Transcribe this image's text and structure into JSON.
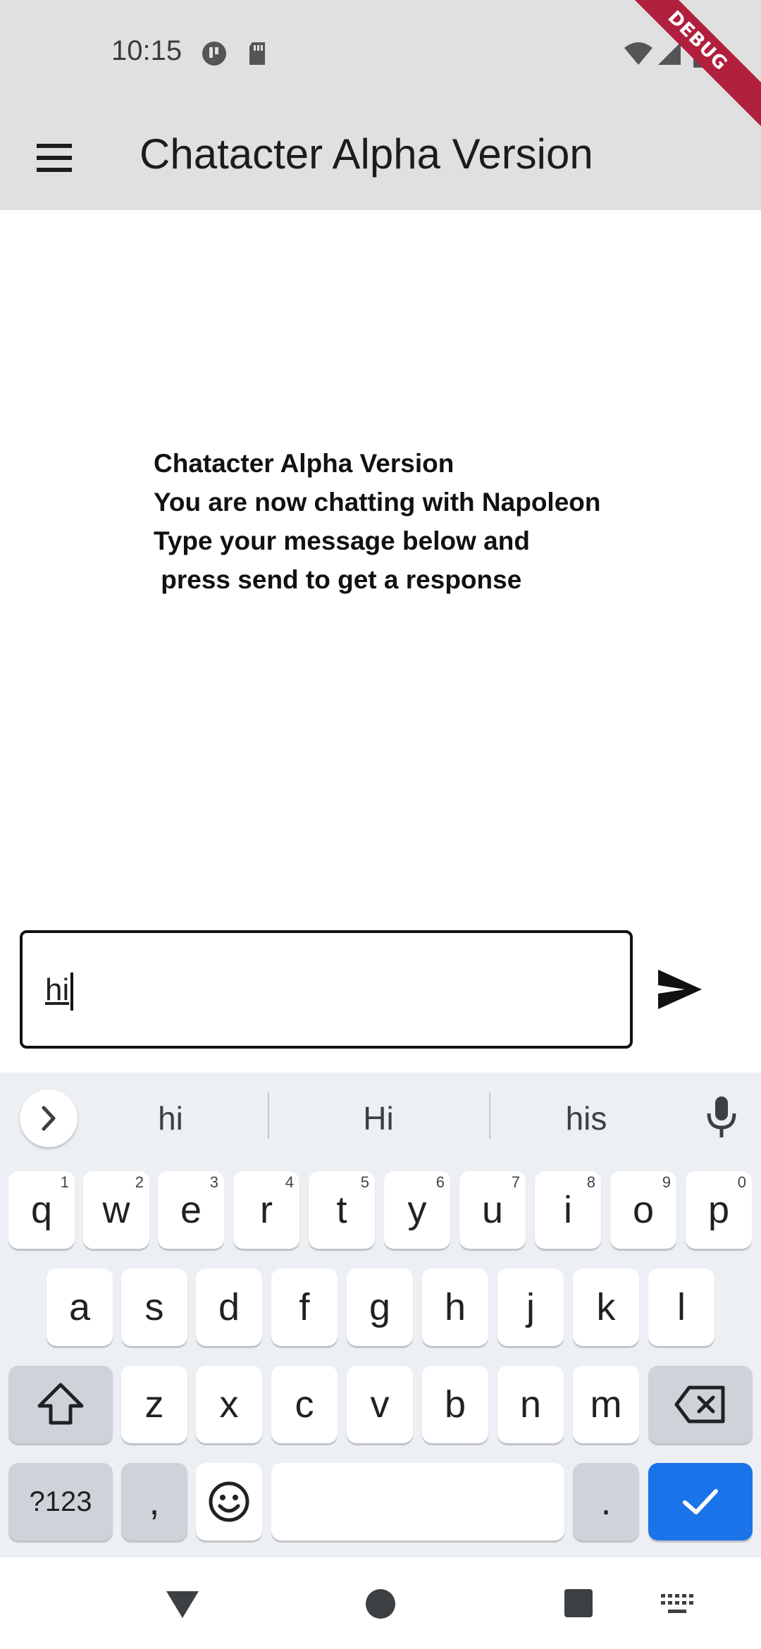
{
  "status_bar": {
    "time": "10:15"
  },
  "debug_banner": "DEBUG",
  "app_bar": {
    "title": "Chatacter Alpha Version"
  },
  "intro": {
    "lines": [
      "Chatacter Alpha Version",
      "You are now chatting with Napoleon",
      "Type your message below and",
      " press send to get a response"
    ]
  },
  "message_input": {
    "value": "hi"
  },
  "keyboard": {
    "suggestions": [
      "hi",
      "Hi",
      "his"
    ],
    "row1": [
      {
        "key": "q",
        "hint": "1"
      },
      {
        "key": "w",
        "hint": "2"
      },
      {
        "key": "e",
        "hint": "3"
      },
      {
        "key": "r",
        "hint": "4"
      },
      {
        "key": "t",
        "hint": "5"
      },
      {
        "key": "y",
        "hint": "6"
      },
      {
        "key": "u",
        "hint": "7"
      },
      {
        "key": "i",
        "hint": "8"
      },
      {
        "key": "o",
        "hint": "9"
      },
      {
        "key": "p",
        "hint": "0"
      }
    ],
    "row2": [
      "a",
      "s",
      "d",
      "f",
      "g",
      "h",
      "j",
      "k",
      "l"
    ],
    "row3": [
      "z",
      "x",
      "c",
      "v",
      "b",
      "n",
      "m"
    ],
    "symbols_label": "?123",
    "comma": ",",
    "period": "."
  },
  "colors": {
    "app_bar": "#e0e0e0",
    "enter_key": "#1a73e8",
    "debug": "#b01f3c"
  }
}
